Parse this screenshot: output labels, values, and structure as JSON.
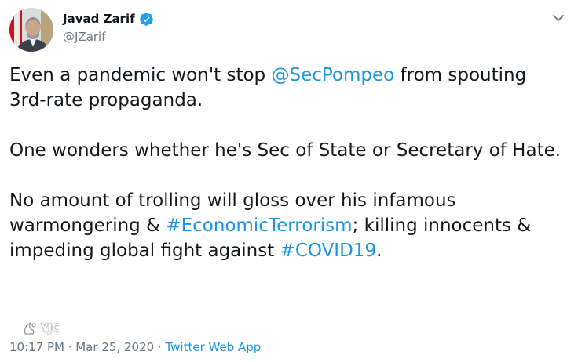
{
  "author": {
    "display_name": "Javad Zarif",
    "handle": "@JZarif",
    "verified": true
  },
  "tweet": {
    "line1_pre": "Even a pandemic won't stop ",
    "mention_pompeo": "@SecPompeo",
    "line1_post": " from spouting 3rd-rate propaganda.",
    "para2": "One wonders whether he's Sec of State or Secretary of Hate.",
    "para3_pre": "No amount of trolling will gloss over his infamous warmongering & ",
    "hashtag_economic": "#EconomicTerrorism",
    "para3_mid": "; killing innocents & impeding global fight against ",
    "hashtag_covid": "#COVID19",
    "para3_post": "."
  },
  "meta": {
    "time": "10:17 PM",
    "sep1": " · ",
    "date": "Mar 25, 2020",
    "sep2": " · ",
    "source": "Twitter Web App"
  },
  "watermark": {
    "text": "YJC"
  },
  "colors": {
    "text": "#14171a",
    "secondary": "#657786",
    "link": "#1b95e0",
    "verified": "#1da1f2"
  }
}
